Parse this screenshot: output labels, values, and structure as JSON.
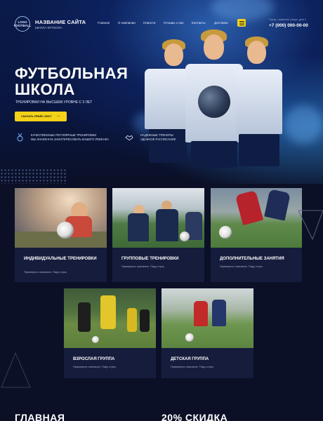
{
  "header": {
    "logo_text": "LOGO\nFOOTBALL",
    "site_name": "НАЗВАНИЕ САЙТА",
    "site_sub": "ШКОЛА ФУТБОЛА",
    "nav": [
      "Главная",
      "О компании",
      "Новости",
      "Отзывы о нас",
      "Контакты",
      "Доставка"
    ],
    "address": "Город, название улицы, дом 1",
    "phone": "+7 (000) 000-00-00"
  },
  "hero": {
    "title_line1": "ФУТБОЛЬНАЯ",
    "title_line2": "ШКОЛА",
    "subtitle": "ТРЕНИРОВКИ НА ВЫСШЕМ УРОВНЕ С 3 ЛЕТ",
    "cta_label": "СКАЧАТЬ ПРАЙС-ЛИСТ",
    "features": [
      {
        "icon": "medal-icon",
        "line1": "КАЧЕСТВЕННЫЕ РЕГУЛЯРНЫЕ ТРЕНИРОВКИ",
        "line2": "МЫ ЗНАЕМ КАК ЗАИНТЕРЕСОВАТЬ ВАШЕГО РЕБЕНКА"
      },
      {
        "icon": "handshake-icon",
        "line1": "НАДЕЖНЫЕ ТРЕНЕРЫ",
        "line2": "УДОБНОЕ РАСПИСАНИЕ"
      }
    ]
  },
  "cards": [
    {
      "title": "ИНДИВИДУАЛЬНЫЕ ТРЕНИРОВКИ",
      "desc": "Примерное описание. Пару строк"
    },
    {
      "title": "ГРУППОВЫЕ ТРЕНИРОВКИ",
      "desc": "Примерное описание. Пару строк"
    },
    {
      "title": "ДОПОЛНИТЕЛЬНЫЕ ЗАНЯТИЯ",
      "desc": "Примерное описание. Пару строк"
    },
    {
      "title": "ВЗРОСЛАЯ ГРУППА",
      "desc": "Примерное описание. Пару строк"
    },
    {
      "title": "ДЕТСКАЯ ГРУППА",
      "desc": "Примерное описание. Пару строк"
    }
  ],
  "bottom": {
    "left_heading": "ГЛАВНАЯ",
    "right_heading": "20% СКИДКА"
  },
  "colors": {
    "accent": "#f4d21a",
    "background": "#0b1027",
    "card": "#161c3c"
  }
}
